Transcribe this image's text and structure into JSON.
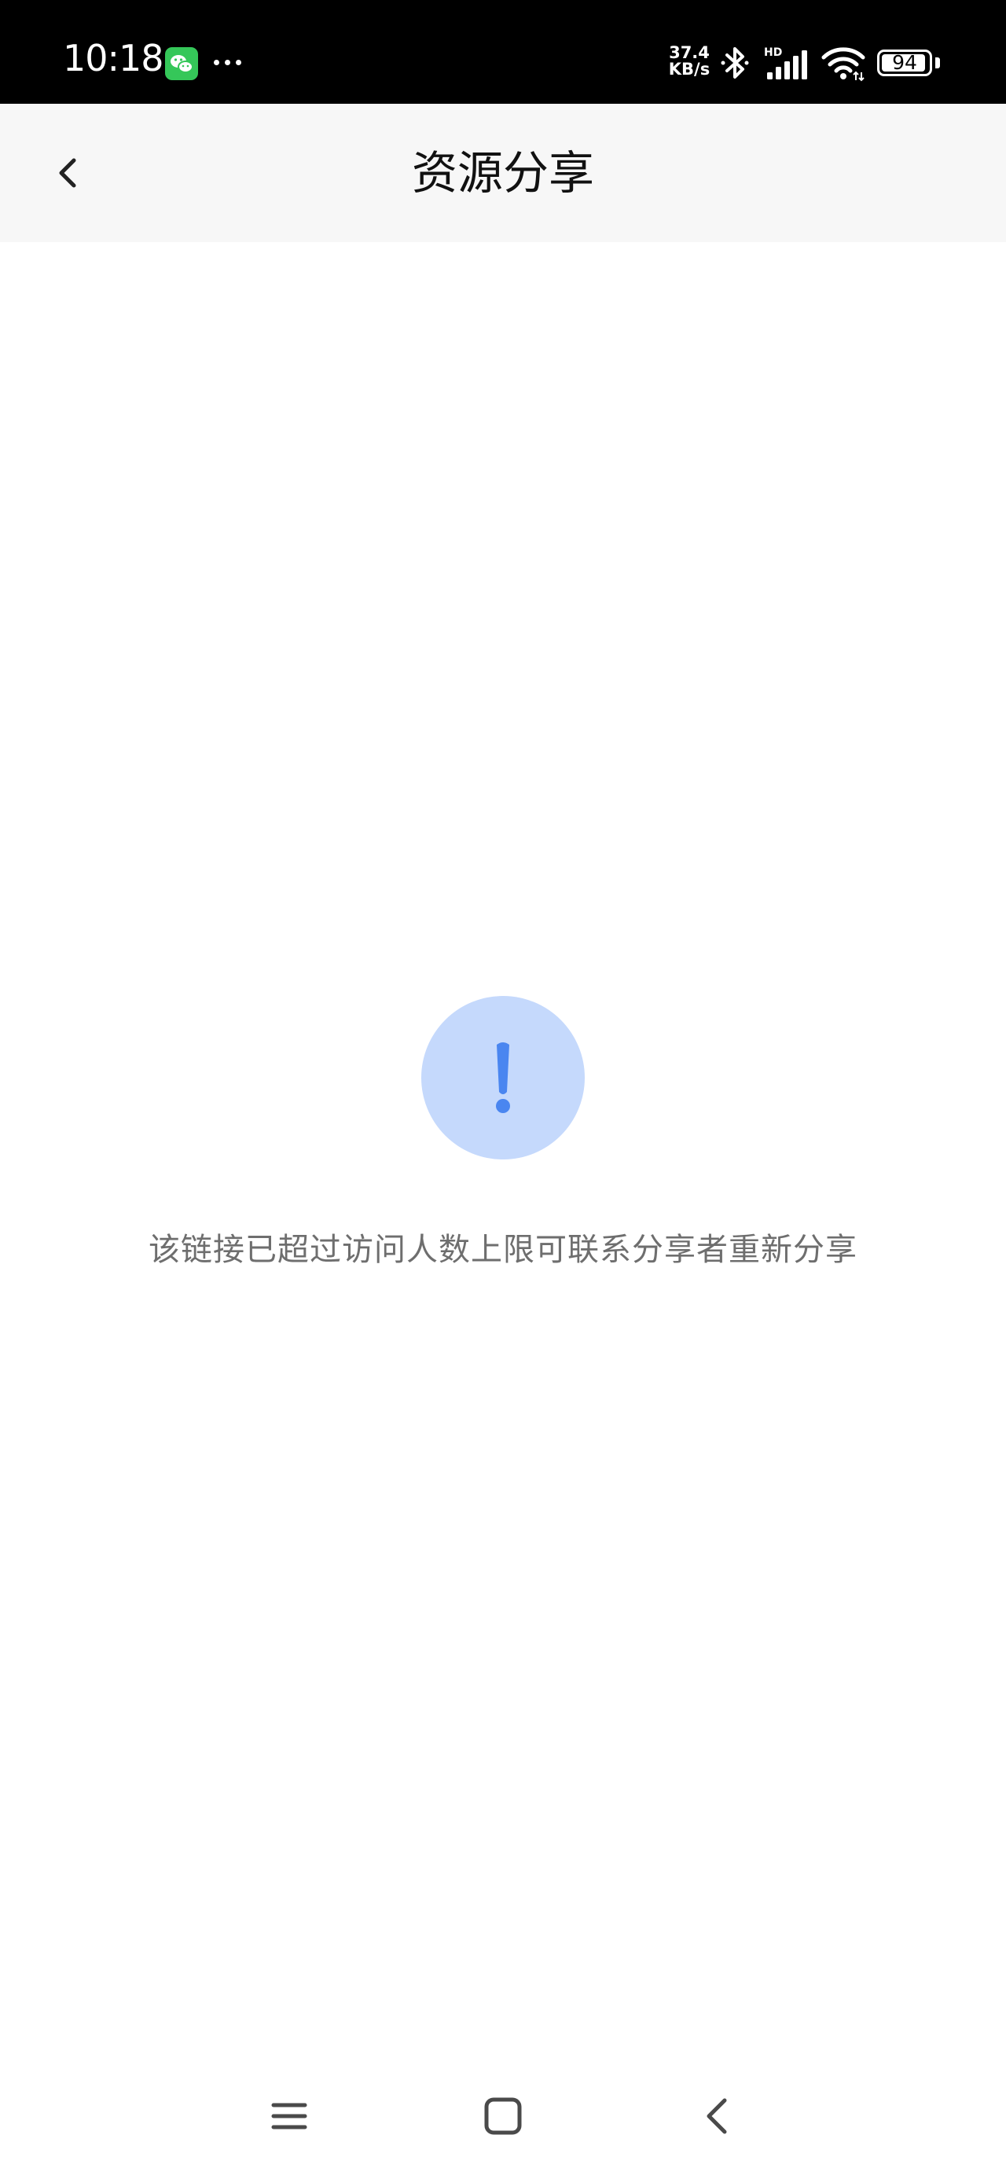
{
  "status_bar": {
    "time": "10:18",
    "net_speed_value": "37.4",
    "net_speed_unit": "KB/s",
    "network_label": "HD",
    "battery_percent": 94,
    "battery_label": "94",
    "notification_icon": "wechat-icon"
  },
  "nav": {
    "title": "资源分享",
    "back_icon": "chevron-left-icon"
  },
  "main": {
    "alert_icon": "exclamation-icon",
    "alert_color": "#4a86f0",
    "alert_bg_color": "#c5d9fc",
    "message": "该链接已超过访问人数上限可联系分享者重新分享"
  },
  "system_nav": {
    "menu_icon": "menu-icon",
    "home_icon": "home-square-icon",
    "back_icon": "back-triangle-icon"
  }
}
